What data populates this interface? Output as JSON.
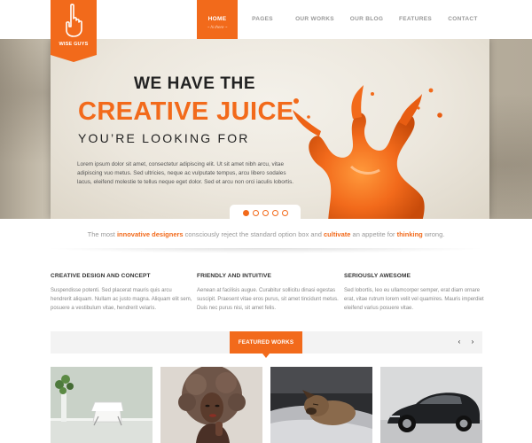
{
  "brand": {
    "name": "WISE GUYS",
    "accent": "#f26a1b"
  },
  "nav": {
    "items": [
      {
        "label": "HOME",
        "sub": "hi there"
      },
      {
        "label": "PAGES"
      },
      {
        "label": "OUR WORKS"
      },
      {
        "label": "OUR BLOG"
      },
      {
        "label": "FEATURES"
      },
      {
        "label": "CONTACT"
      }
    ]
  },
  "hero": {
    "line1": "WE HAVE THE",
    "line2": "CREATIVE JUICE",
    "line3": "YOU’RE LOOKING FOR",
    "body": "Lorem ipsum dolor sit amet, consectetur adipiscing elit. Ut sit amet nibh arcu, vitae adipiscing vuo metus. Sed ultricies, neque ac vulputate tempus, arcu libero sodales lacus, eleifend molestie te tellus neque eget dolor. Sed et arcu non orci iaculis lobortis.",
    "slides": 5,
    "active_slide": 1
  },
  "tagline": {
    "p1": "The most ",
    "h1": "innovative designers",
    "p2": " consciously reject the standard option box and ",
    "h2": "cultivate",
    "p3": " an appetite for ",
    "h3": "thinking",
    "p4": " wrong."
  },
  "columns": [
    {
      "title": "CREATIVE DESIGN AND CONCEPT",
      "text": "Suspendisse potenti. Sed placerat mauris quis arcu hendrerit aliquam. Nullam ac justo magna. Aliquam elit sem, posuere a vestibulum vitae, hendrerit velaris."
    },
    {
      "title": "FRIENDLY AND INTUITIVE",
      "text": "Aenean at facilisis augue. Curabitur sollicitu dinasi egestas suscipit. Praesent vitae eros purus, sit amet tincidunt metus. Duis nec purus nisi, sit amet felis."
    },
    {
      "title": "SERIOUSLY AWESOME",
      "text": "Sed lobortis, leo eu ullamcorper semper, erat diam ornare erat, vitae rutrum lorem velit vel quamires. Mauris imperdiet eleifend varius posuere vitae."
    }
  ],
  "featured": {
    "label": "FEATURED WORKS",
    "prev": "‹",
    "next": "›",
    "items": [
      "white-chair-interior",
      "curly-hair-portrait",
      "sleeping-dog",
      "black-car"
    ]
  }
}
